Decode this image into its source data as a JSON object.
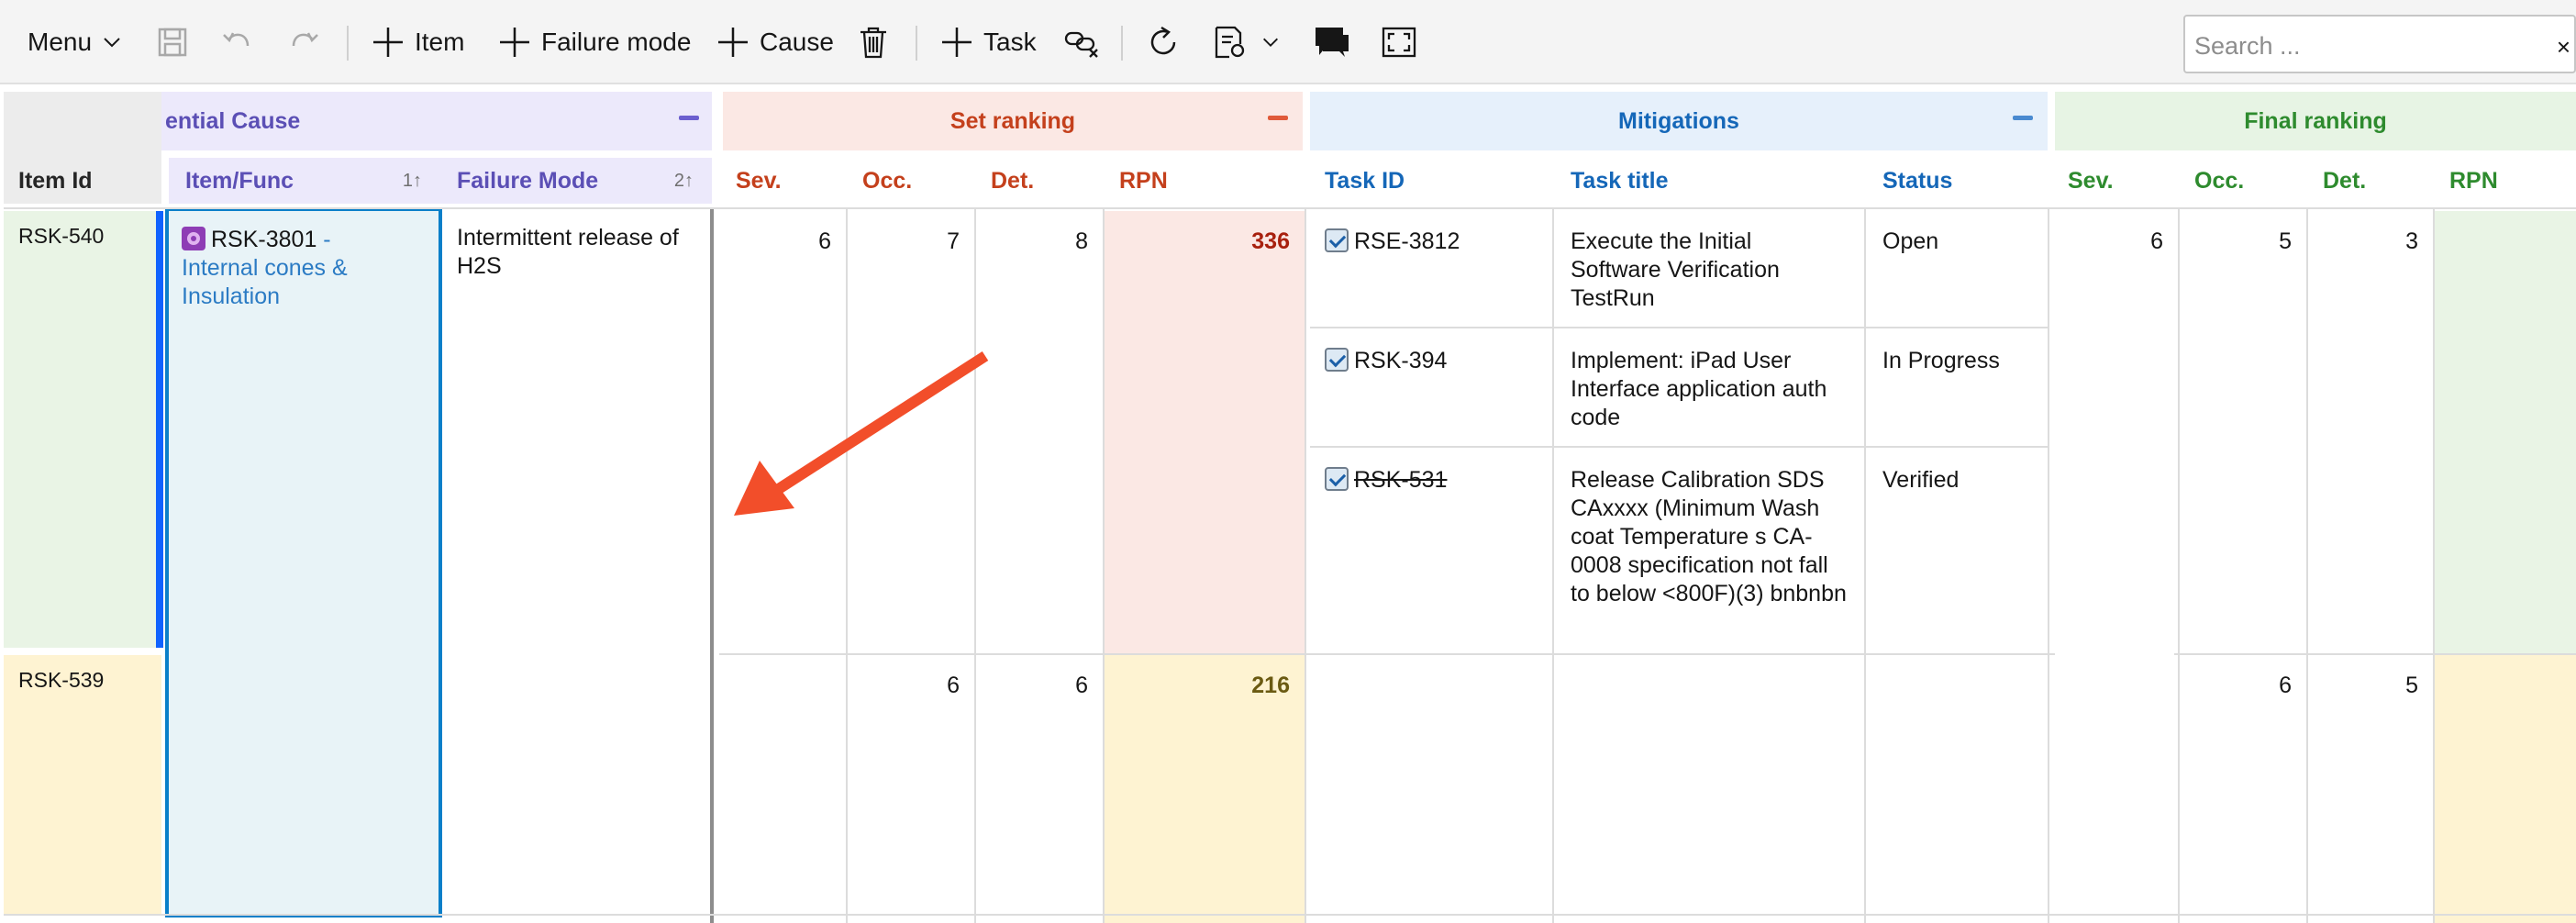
{
  "toolbar": {
    "menu_label": "Menu",
    "add_item_label": "Item",
    "add_failure_mode_label": "Failure mode",
    "add_cause_label": "Cause",
    "add_task_label": "Task",
    "search_placeholder": "Search ...",
    "search_clear": "×"
  },
  "groups": {
    "potential_cause": "ential Cause",
    "set_ranking": "Set ranking",
    "mitigations": "Mitigations",
    "final_ranking": "Final ranking"
  },
  "columns": {
    "item_id": "Item Id",
    "item_func": "Item/Func",
    "item_func_sort": "1↑",
    "failure_mode": "Failure Mode",
    "failure_mode_sort": "2↑",
    "sev": "Sev.",
    "occ": "Occ.",
    "det": "Det.",
    "rpn": "RPN",
    "task_id": "Task ID",
    "task_title": "Task title",
    "status": "Status",
    "final_sev": "Sev.",
    "final_occ": "Occ.",
    "final_det": "Det.",
    "final_rpn": "RPN"
  },
  "rows": [
    {
      "item_id": "RSK-540",
      "item_func_id": "RSK-3801",
      "item_func_sep": " -",
      "item_func_name": "Internal cones & Insulation",
      "failure_mode": "Intermittent release of H2S",
      "sev": "6",
      "occ": "7",
      "det": "8",
      "rpn": "336",
      "tasks": [
        {
          "id": "RSE-3812",
          "title": "Execute the Initial Software Verification TestRun",
          "status": "Open"
        },
        {
          "id": "RSK-394",
          "title": "Implement: iPad User Interface application auth code",
          "status": "In Progress"
        },
        {
          "id": "RSK-531",
          "title": "Release Calibration SDS CAxxxx (Minimum Wash coat Temperature s CA-0008 specification not fall to below <800F)(3) bnbnbn",
          "status": "Verified"
        }
      ],
      "final_sev": "6",
      "final_occ": "5",
      "final_det": "3"
    },
    {
      "item_id": "RSK-539",
      "occ": "6",
      "det": "6",
      "rpn": "216",
      "final_occ": "6",
      "final_det": "5"
    }
  ],
  "colors": {
    "potential_cause": "#5b4fb5",
    "set_ranking": "#c4401c",
    "mitigations": "#1567b8",
    "final_ranking": "#2e8b2e",
    "row1_bg": "#e9f4e5",
    "row2_bg": "#fef3d2",
    "annotation_arrow": "#f24e2a"
  }
}
